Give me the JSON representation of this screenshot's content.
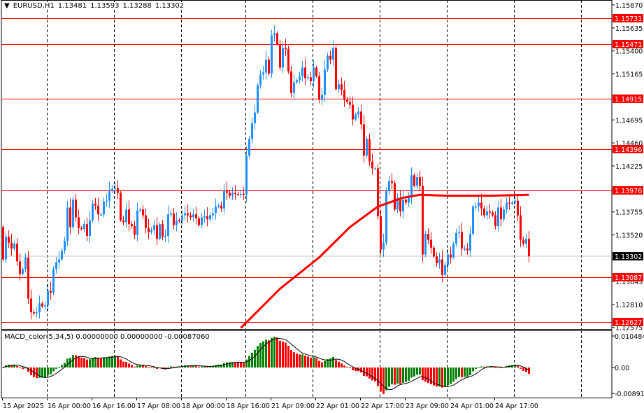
{
  "header": {
    "menu_icon": "triangle-down-icon",
    "symbol": "EURUSD,H1",
    "open": "1.13481",
    "high": "1.13593",
    "low": "1.13288",
    "close": "1.13302"
  },
  "macd_title": "MACD_color(5,34,5) 0.00000000 0.00000000 -0.00087060",
  "colors": {
    "bull": "#1e90ff",
    "bear": "#ff0000",
    "level": "#ff0000",
    "bid": "#c0c0c0",
    "grid": "#000000",
    "macd_up": "#008000",
    "macd_down": "#ff0000"
  },
  "price_axis": {
    "ticks": [
      "1.15870",
      "1.15635",
      "1.15400",
      "1.15165",
      "1.14695",
      "1.14460",
      "1.14225",
      "1.13755",
      "1.13520",
      "1.13045",
      "1.12810",
      "1.12575"
    ],
    "levels": [
      "1.15731",
      "1.15471",
      "1.14915",
      "1.14396",
      "1.13976",
      "1.13087",
      "1.12627"
    ],
    "bid": "1.13302"
  },
  "macd_axis": {
    "top": "0.0104847",
    "zero": "0.00",
    "bottom": "-0.0089170"
  },
  "time_axis": [
    "15 Apr 2025",
    "16 Apr 00:00",
    "16 Apr 16:00",
    "17 Apr 08:00",
    "18 Apr 00:00",
    "18 Apr 16:00",
    "21 Apr 09:00",
    "22 Apr 01:00",
    "22 Apr 17:00",
    "23 Apr 09:00",
    "24 Apr 01:00",
    "24 Apr 17:00"
  ],
  "chart_data": {
    "type": "candlestick",
    "symbol": "EURUSD",
    "timeframe": "H1",
    "ylim": [
      1.12575,
      1.1587
    ],
    "first_open": 1.136,
    "closes": [
      1.1327,
      1.135,
      1.1344,
      1.1338,
      1.1343,
      1.1325,
      1.1312,
      1.1317,
      1.1329,
      1.1287,
      1.1273,
      1.1272,
      1.1273,
      1.1282,
      1.1279,
      1.128,
      1.1295,
      1.1293,
      1.1317,
      1.1324,
      1.1327,
      1.1336,
      1.1346,
      1.138,
      1.136,
      1.1388,
      1.137,
      1.1359,
      1.1358,
      1.1363,
      1.1351,
      1.1367,
      1.1384,
      1.1382,
      1.1373,
      1.1373,
      1.1386,
      1.1387,
      1.1397,
      1.1399,
      1.14,
      1.1395,
      1.1367,
      1.1365,
      1.1378,
      1.1363,
      1.1361,
      1.1352,
      1.1377,
      1.1378,
      1.1372,
      1.1359,
      1.1355,
      1.1357,
      1.1362,
      1.1348,
      1.1363,
      1.135,
      1.1351,
      1.1373,
      1.1374,
      1.1362,
      1.1367,
      1.1366,
      1.1372,
      1.1374,
      1.1372,
      1.137,
      1.1373,
      1.1369,
      1.1362,
      1.137,
      1.1371,
      1.1368,
      1.1372,
      1.1374,
      1.1381,
      1.1382,
      1.1379,
      1.1397,
      1.1395,
      1.1392,
      1.1395,
      1.1394,
      1.1393,
      1.1394,
      1.1393,
      1.1433,
      1.145,
      1.1466,
      1.1477,
      1.1505,
      1.1516,
      1.1518,
      1.1531,
      1.1517,
      1.1556,
      1.1558,
      1.1547,
      1.1523,
      1.1543,
      1.1542,
      1.1519,
      1.1497,
      1.1508,
      1.151,
      1.1514,
      1.1523,
      1.1512,
      1.1513,
      1.1509,
      1.1523,
      1.1514,
      1.149,
      1.1495,
      1.1521,
      1.1535,
      1.1531,
      1.1543,
      1.1501,
      1.1506,
      1.15,
      1.149,
      1.1488,
      1.1485,
      1.147,
      1.1475,
      1.1478,
      1.1465,
      1.1433,
      1.145,
      1.1427,
      1.142,
      1.142,
      1.1371,
      1.1337,
      1.1344,
      1.1397,
      1.1407,
      1.1405,
      1.1378,
      1.139,
      1.1376,
      1.1388,
      1.1385,
      1.139,
      1.1413,
      1.1402,
      1.1411,
      1.1402,
      1.1332,
      1.1353,
      1.1347,
      1.1339,
      1.133,
      1.1323,
      1.1327,
      1.1311,
      1.1321,
      1.1332,
      1.1329,
      1.1343,
      1.1354,
      1.1355,
      1.1338,
      1.1338,
      1.1336,
      1.1353,
      1.1381,
      1.1381,
      1.1385,
      1.1379,
      1.1372,
      1.1376,
      1.1375,
      1.1372,
      1.1361,
      1.138,
      1.1368,
      1.1378,
      1.1385,
      1.1384,
      1.1385,
      1.1387,
      1.1372,
      1.1347,
      1.1343,
      1.1348,
      1.13302
    ],
    "moving_average": [
      [
        85,
        1.1257
      ],
      [
        99,
        1.1297
      ],
      [
        113,
        1.1329
      ],
      [
        124,
        1.136
      ],
      [
        134,
        1.1381
      ],
      [
        143,
        1.139
      ],
      [
        149,
        1.1393
      ],
      [
        159,
        1.1392
      ],
      [
        174,
        1.1392
      ],
      [
        188,
        1.1393
      ]
    ],
    "indicator": {
      "name": "MACD_color",
      "fast": 5,
      "slow": 34,
      "signal": 5
    }
  }
}
